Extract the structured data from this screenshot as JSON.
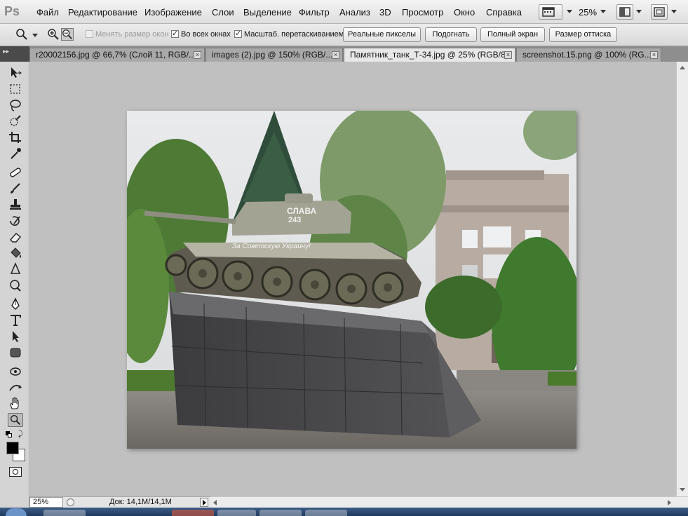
{
  "menubar": {
    "logo": "Ps",
    "items": [
      "Файл",
      "Редактирование",
      "Изображение",
      "Слои",
      "Выделение",
      "Фильтр",
      "Анализ",
      "3D",
      "Просмотр",
      "Окно",
      "Справка"
    ],
    "zoom": "25%"
  },
  "options": {
    "resize_windows_label": "Менять размер окон",
    "all_windows_label": "Во всех окнах",
    "scrubby_zoom_label": "Масштаб. перетаскиванием",
    "actual_pixels": "Реальные пикселы",
    "fit_screen": "Подогнать",
    "fill_screen": "Полный экран",
    "print_size": "Размер оттиска",
    "resize_windows_checked": false,
    "all_windows_checked": true,
    "scrubby_zoom_checked": true
  },
  "tabs": [
    {
      "label": "r20002156.jpg @ 66,7% (Слой 11, RGB/...",
      "active": false
    },
    {
      "label": "images (2).jpg @ 150% (RGB/...",
      "active": false
    },
    {
      "label": "Памятник_танк_Т-34.jpg @ 25% (RGB/8)",
      "active": true
    },
    {
      "label": "screenshot.15.png @ 100% (RG...",
      "active": false
    }
  ],
  "tank": {
    "turret_text": "СЛАВА",
    "number": "243",
    "slogan": "За Советскую Украину!"
  },
  "status": {
    "zoom": "25%",
    "doc_info": "Док: 14,1M/14,1M"
  },
  "colors": {
    "foreground": "#000000",
    "background": "#ffffff",
    "canvas": "#c0c0c0"
  },
  "icons": [
    "move-tool-icon",
    "marquee-tool-icon",
    "lasso-tool-icon",
    "quick-selection-tool-icon",
    "crop-tool-icon",
    "eyedropper-tool-icon",
    "healing-brush-tool-icon",
    "brush-tool-icon",
    "clone-stamp-tool-icon",
    "history-brush-tool-icon",
    "eraser-tool-icon",
    "paint-bucket-tool-icon",
    "blur-tool-icon",
    "dodge-tool-icon",
    "pen-tool-icon",
    "type-tool-icon",
    "path-selection-tool-icon",
    "shape-tool-icon",
    "3d-rotate-tool-icon",
    "3d-orbit-tool-icon",
    "hand-tool-icon",
    "zoom-tool-icon"
  ]
}
